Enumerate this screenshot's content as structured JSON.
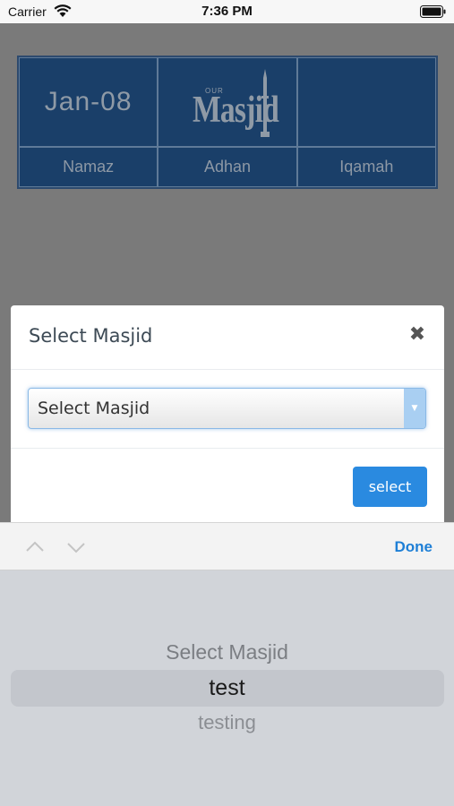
{
  "status_bar": {
    "carrier": "Carrier",
    "time": "7:36 PM"
  },
  "prayer_table": {
    "date": "Jan-08",
    "logo": {
      "small_text": "OUR",
      "main_text": "Masjid"
    },
    "headers": [
      "Namaz",
      "Adhan",
      "Iqamah"
    ]
  },
  "modal": {
    "title": "Select Masjid",
    "select_value": "Select Masjid",
    "select_button": "select"
  },
  "toolbar": {
    "done_label": "Done"
  },
  "picker": {
    "options": [
      "Select Masjid",
      "test",
      "testing"
    ],
    "selected": "test"
  },
  "colors": {
    "accent": "#2a8ae0",
    "table_bg": "#1a3f69",
    "done": "#1e7fd6"
  }
}
